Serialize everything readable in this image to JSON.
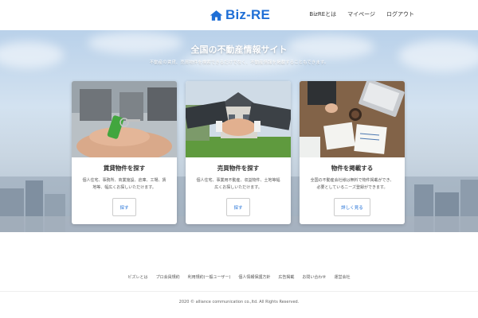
{
  "header": {
    "logo_text": "Biz-RE",
    "nav": [
      {
        "label": "BizREとは"
      },
      {
        "label": "マイページ"
      },
      {
        "label": "ログアウト"
      }
    ]
  },
  "hero": {
    "title": "全国の不動産情報サイト",
    "subtitle": "不動産の賃貸、売買物件を検索できるだけでなく、不動産情報を掲載することもできます。"
  },
  "cards": [
    {
      "title": "賃貸物件を探す",
      "desc_line1": "個人住宅、事務所、商業施設、倉庫、工場、賃",
      "desc_line2": "地等、幅広くお探しいただけます。",
      "button": "探す",
      "image": "key-in-hand"
    },
    {
      "title": "売買物件を探す",
      "desc_line1": "個人住宅、事業用不動産、収益物件、土地等幅",
      "desc_line2": "広くお探しいただけます。",
      "button": "探す",
      "image": "handshake-house"
    },
    {
      "title": "物件を掲載する",
      "desc_line1": "全国の不動産会社様は無料で物件掲載ができ、",
      "desc_line2": "必要としているニーズ登録ができます。",
      "button": "詳しく見る",
      "image": "business-desk"
    }
  ],
  "footer": {
    "links": [
      {
        "label": "ビズレとは"
      },
      {
        "label": "プロ会員規約"
      },
      {
        "label": "利用規約(一般ユーザー)"
      },
      {
        "label": "個人情報保護方針"
      },
      {
        "label": "広告掲載"
      },
      {
        "label": "お問い合わせ"
      },
      {
        "label": "運営会社"
      }
    ],
    "copyright": "2020 © alliance communication co.,ltd. All Rights Reserved."
  },
  "colors": {
    "brand": "#1f6fd6",
    "hero_sky": "#c9dbee",
    "card_bg": "#ffffff"
  }
}
